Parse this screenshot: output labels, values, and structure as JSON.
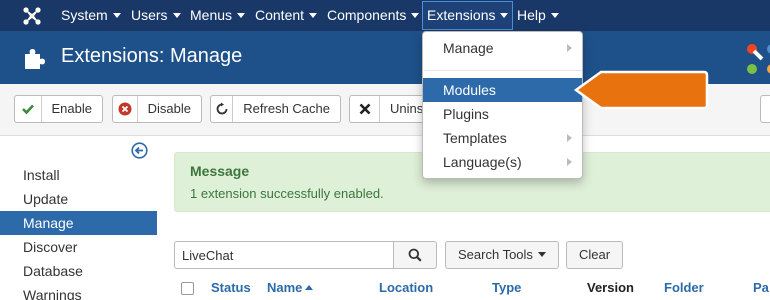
{
  "navbar": {
    "items": [
      {
        "label": "System"
      },
      {
        "label": "Users"
      },
      {
        "label": "Menus"
      },
      {
        "label": "Content"
      },
      {
        "label": "Components"
      },
      {
        "label": "Extensions"
      },
      {
        "label": "Help"
      }
    ]
  },
  "header": {
    "title": "Extensions: Manage"
  },
  "toolbar": {
    "enable_label": "Enable",
    "disable_label": "Disable",
    "refresh_label": "Refresh Cache",
    "uninstall_label": "Uninst"
  },
  "sidebar": {
    "items": [
      {
        "label": "Install"
      },
      {
        "label": "Update"
      },
      {
        "label": "Manage"
      },
      {
        "label": "Discover"
      },
      {
        "label": "Database"
      },
      {
        "label": "Warnings"
      }
    ]
  },
  "alert": {
    "title": "Message",
    "text": "1 extension successfully enabled."
  },
  "filters": {
    "search_value": "LiveChat",
    "search_tools_label": "Search Tools",
    "clear_label": "Clear"
  },
  "table": {
    "headers": [
      "Status",
      "Name",
      "Location",
      "Type",
      "Version",
      "Folder",
      "Pa"
    ]
  },
  "dropdown": {
    "items": [
      {
        "label": "Manage"
      },
      {
        "label": "Modules"
      },
      {
        "label": "Plugins"
      },
      {
        "label": "Templates"
      },
      {
        "label": "Language(s)"
      }
    ]
  },
  "colors": {
    "navbar": "#1a3867",
    "header": "#1e518a",
    "accent": "#2c6aa9",
    "callout": "#e8730e",
    "success_bg": "#dff0d8"
  }
}
